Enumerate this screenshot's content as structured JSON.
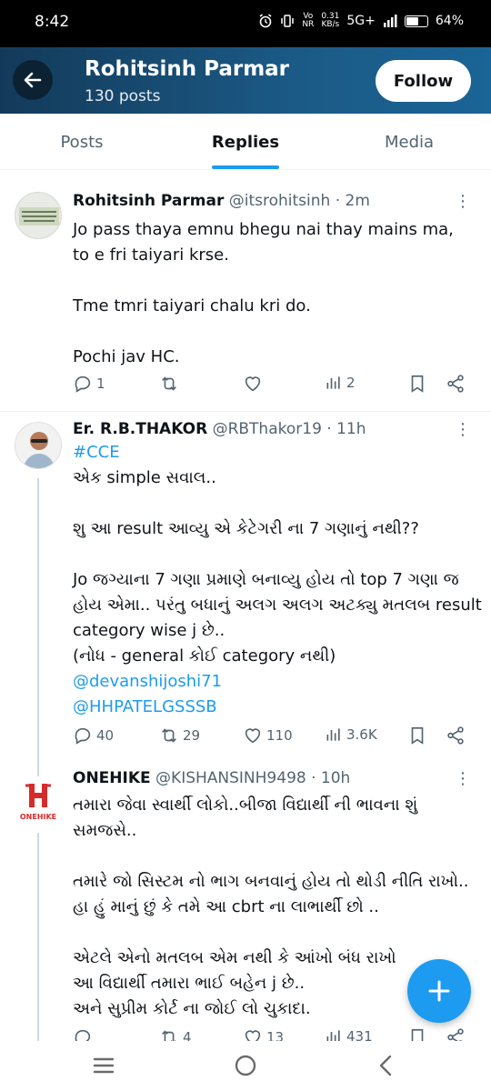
{
  "status_bar": {
    "time": "8:42",
    "net_speed_value": "0.31",
    "net_speed_unit": "KB/s",
    "network": "5G+",
    "volte_top": "Vo",
    "volte_bottom": "NR",
    "battery_percent": "64%",
    "battery_level": 0.64
  },
  "header": {
    "name": "Rohitsinh Parmar",
    "posts_count": "130 posts",
    "follow_label": "Follow"
  },
  "tabs": [
    {
      "label": "Posts",
      "active": false
    },
    {
      "label": "Replies",
      "active": true
    },
    {
      "label": "Media",
      "active": false
    }
  ],
  "tweets": [
    {
      "display_name": "Rohitsinh Parmar",
      "meta": "@itsrohitsinh · 2m",
      "lines": [
        "Jo pass thaya emnu bhegu nai thay mains ma,",
        "to e fri taiyari krse.",
        "",
        "Tme tmri taiyari chalu kri do.",
        "",
        "Pochi jav HC."
      ],
      "replies": "1",
      "reposts": "",
      "likes": "",
      "views": "2"
    },
    {
      "display_name": "Er. R.B.THAKOR",
      "meta": "@RBThakor19 · 11h",
      "hashtag": "#CCE",
      "lines": [
        "એક simple સવાલ..",
        "",
        "શુ આ result આવ્યુ એ કેટેગરી ના 7 ગણાનું નથી??",
        "",
        "Jo જગ્યાના 7 ગણા પ્રમાણે બનાવ્યુ હોય તો top 7 ગણા જ",
        "હોય એમા.. પરંતુ બધાનું અલગ અલગ અટક્યુ મતલબ result",
        "category wise j છે..",
        "(નોધ - general કોઈ category નથી)"
      ],
      "mentions": [
        "@devanshijoshi71",
        "@HHPATELGSSSB"
      ],
      "replies": "40",
      "reposts": "29",
      "likes": "110",
      "views": "3.6K"
    },
    {
      "display_name": "ONEHIKE",
      "meta": "@KISHANSINH9498 · 10h",
      "avatar_text": "ONEHIKE",
      "lines": [
        "તમારા જેવા સ્વાર્થી લોકો..બીજા વિદ્યાર્થી ની ભાવના શું",
        "સમજસે..",
        "",
        "તમારે જો સિસ્ટમ નો ભાગ બનવાનું હોય તો થોડી નીતિ રાખો..",
        "હા હું માનું છું કે તમે આ cbrt ના લાભાર્થી છો ..",
        "",
        "એટલે એનો મતલબ એમ નથી કે આંખો બંધ રાખો",
        "આ વિદ્યાર્થી તમારા ભાઈ બહેન j છે..",
        "અને સુપ્રીમ કોર્ટ ના જોઈ લો ચુકાદા."
      ],
      "replies": "",
      "reposts": "4",
      "likes": "13",
      "views": "431"
    }
  ],
  "colors": {
    "accent": "#1d9bf0",
    "header_dark": "#133a5a",
    "header_light": "#1a6496",
    "text": "#0f1419",
    "secondary": "#536471"
  }
}
